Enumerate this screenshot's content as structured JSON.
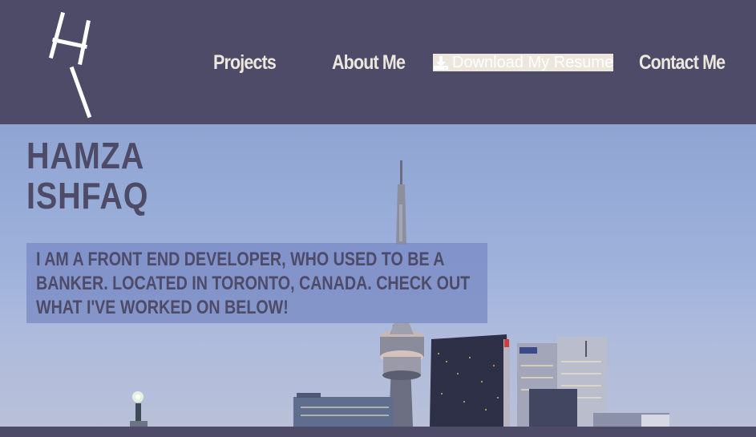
{
  "header": {
    "logo_text": "H I",
    "nav": {
      "projects": "Projects",
      "about": "About Me",
      "resume": "Download My Resume",
      "contact": "Contact Me"
    },
    "resume_icon": "download-icon"
  },
  "hero": {
    "name_line1": "HAMZA",
    "name_line2": "ISHFAQ",
    "bio": "I am a front end developer, who used to be a banker. Located in Toronto, Canada. Check out what I've worked on below!",
    "background_image": "toronto-skyline-cn-tower"
  },
  "colors": {
    "primary": "#4d4b68",
    "nav_text": "#ede6dc",
    "sky": "#9db1db"
  }
}
